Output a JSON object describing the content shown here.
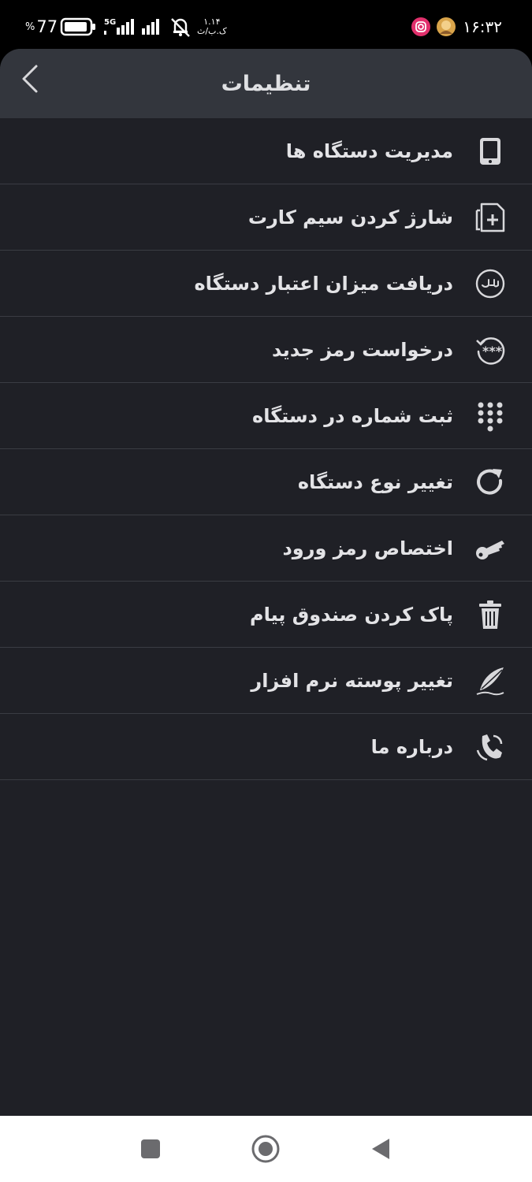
{
  "status_bar": {
    "battery_percent": "77",
    "percent_sign": "%",
    "network": "5G",
    "speed_value": "۱.۱۴",
    "speed_unit": "ک.ب/ث",
    "time": "۱۶:۳۲"
  },
  "header": {
    "title": "تنظیمات"
  },
  "menu": {
    "items": [
      {
        "label": "مدیریت دستگاه ها",
        "icon": "tablet-icon"
      },
      {
        "label": "شارژ کردن سیم کارت",
        "icon": "sim-add-icon"
      },
      {
        "label": "دریافت میزان اعتبار دستگاه",
        "icon": "rial-icon"
      },
      {
        "label": "درخواست رمز جدید",
        "icon": "password-reset-icon"
      },
      {
        "label": "ثبت شماره در دستگاه",
        "icon": "dialpad-icon"
      },
      {
        "label": "تغییر نوع دستگاه",
        "icon": "refresh-icon"
      },
      {
        "label": "اختصاص رمز ورود",
        "icon": "key-icon"
      },
      {
        "label": "پاک کردن صندوق پیام",
        "icon": "trash-icon"
      },
      {
        "label": "تغییر پوسته نرم افزار",
        "icon": "feather-icon"
      },
      {
        "label": "درباره ما",
        "icon": "phone-icon"
      }
    ]
  },
  "colors": {
    "background": "#1f2026",
    "header": "#33363d",
    "divider": "#3a3c43",
    "text": "#e3e3e6",
    "icon": "#d8d8db"
  }
}
